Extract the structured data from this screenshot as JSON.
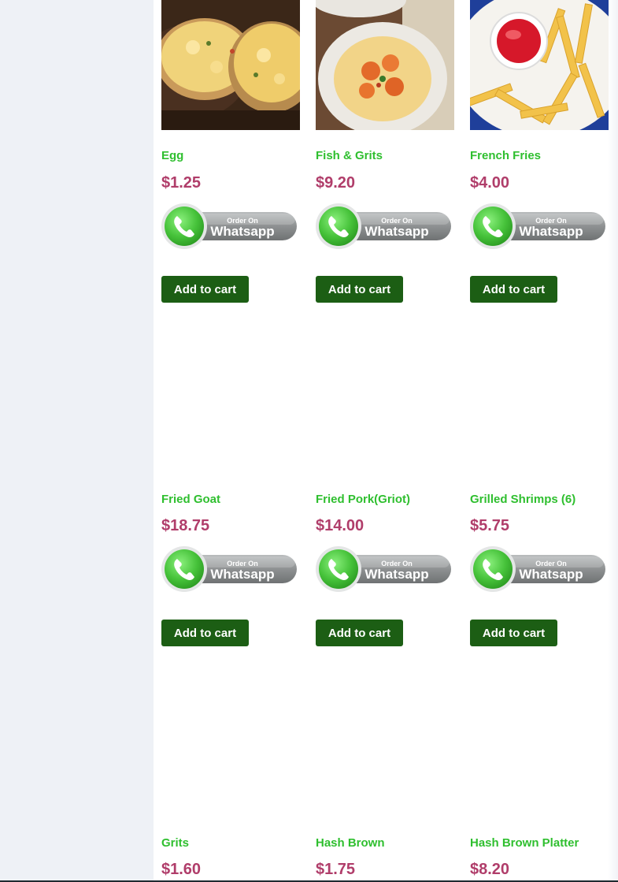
{
  "colors": {
    "product_name": "#2fbf2f",
    "price": "#b03d6a",
    "add_to_cart_bg": "#1c5e14",
    "sidebar_bg": "#eef1f6"
  },
  "whatsapp_badge": {
    "line1": "Order On",
    "line2": "Whatsapp",
    "icon": "whatsapp-phone-icon"
  },
  "add_to_cart_label": "Add to cart",
  "products": [
    {
      "name": "Egg",
      "price": "$1.25"
    },
    {
      "name": "Fish & Grits",
      "price": "$9.20"
    },
    {
      "name": "French Fries",
      "price": "$4.00"
    },
    {
      "name": "Fried Goat",
      "price": "$18.75"
    },
    {
      "name": "Fried Pork(Griot)",
      "price": "$14.00"
    },
    {
      "name": "Grilled Shrimps (6)",
      "price": "$5.75"
    },
    {
      "name": "Grits",
      "price": "$1.60"
    },
    {
      "name": "Hash Brown",
      "price": "$1.75"
    },
    {
      "name": "Hash Brown Platter",
      "price": "$8.20"
    }
  ]
}
